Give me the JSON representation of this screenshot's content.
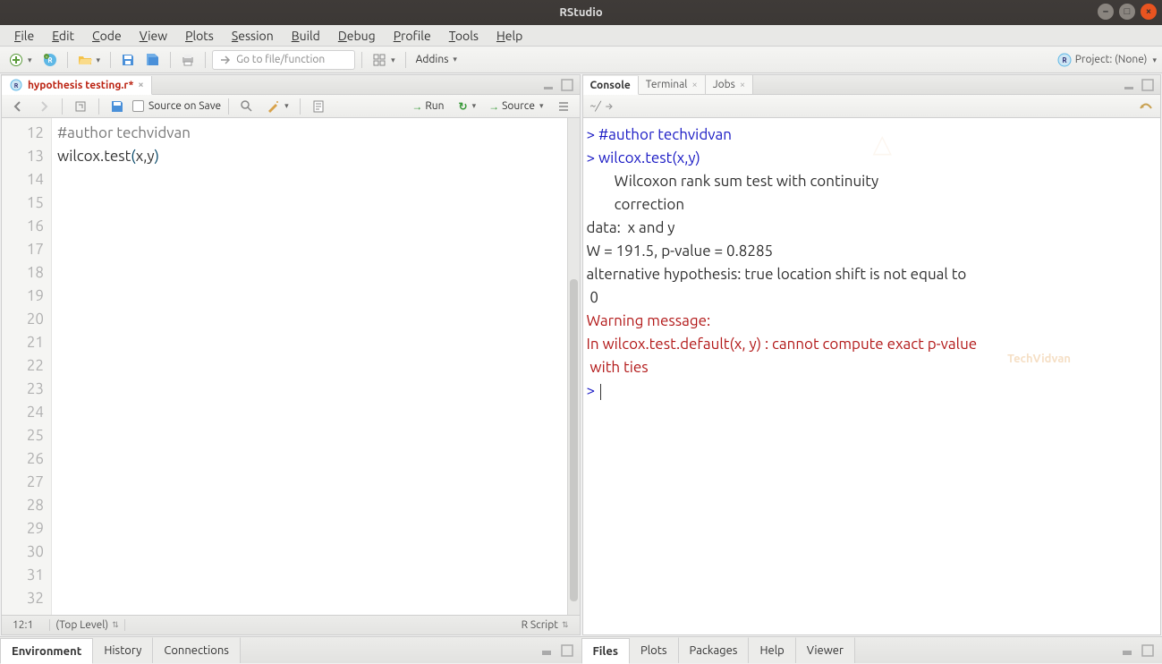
{
  "titlebar": {
    "title": "RStudio"
  },
  "menu": {
    "file": "File",
    "edit": "Edit",
    "code": "Code",
    "view": "View",
    "plots": "Plots",
    "session": "Session",
    "build": "Build",
    "debug": "Debug",
    "profile": "Profile",
    "tools": "Tools",
    "help": "Help"
  },
  "toolbar": {
    "goto_placeholder": "Go to file/function",
    "addins": "Addins",
    "project": "Project: (None)"
  },
  "source_tab": {
    "filename": "hypothesis testing.r*",
    "dirty_marker": ""
  },
  "editor_toolbar": {
    "source_on_save": "Source on Save",
    "run": "Run",
    "source": "Source"
  },
  "editor": {
    "first_line_no": 12,
    "lines": [
      "#author techvidvan",
      "wilcox.test(x,y)",
      "",
      "",
      "",
      "",
      "",
      "",
      "",
      "",
      "",
      "",
      "",
      "",
      "",
      "",
      "",
      "",
      "",
      "",
      ""
    ],
    "line_count_display": 21
  },
  "editor_status": {
    "pos": "12:1",
    "scope": "(Top Level)",
    "lang": "R Script"
  },
  "left_lower_tabs": [
    "Environment",
    "History",
    "Connections"
  ],
  "right_tabs": {
    "console": "Console",
    "terminal": "Terminal",
    "jobs": "Jobs",
    "cwd": "~/"
  },
  "console_lines": [
    {
      "cls": "prompt",
      "text": "> #author techvidvan"
    },
    {
      "cls": "prompt",
      "text": "> wilcox.test(x,y)"
    },
    {
      "cls": "",
      "text": ""
    },
    {
      "cls": "",
      "text": "        Wilcoxon rank sum test with continuity"
    },
    {
      "cls": "",
      "text": "        correction"
    },
    {
      "cls": "",
      "text": ""
    },
    {
      "cls": "",
      "text": "data:  x and y"
    },
    {
      "cls": "",
      "text": "W = 191.5, p-value = 0.8285"
    },
    {
      "cls": "",
      "text": "alternative hypothesis: true location shift is not equal to"
    },
    {
      "cls": "",
      "text": " 0"
    },
    {
      "cls": "",
      "text": ""
    },
    {
      "cls": "warn",
      "text": "Warning message:"
    },
    {
      "cls": "warn",
      "text": "In wilcox.test.default(x, y) : cannot compute exact p-value"
    },
    {
      "cls": "warn",
      "text": " with ties"
    },
    {
      "cls": "prompt",
      "text": "> "
    }
  ],
  "right_lower_tabs": [
    "Files",
    "Plots",
    "Packages",
    "Help",
    "Viewer"
  ],
  "watermark": "TechVidvan"
}
